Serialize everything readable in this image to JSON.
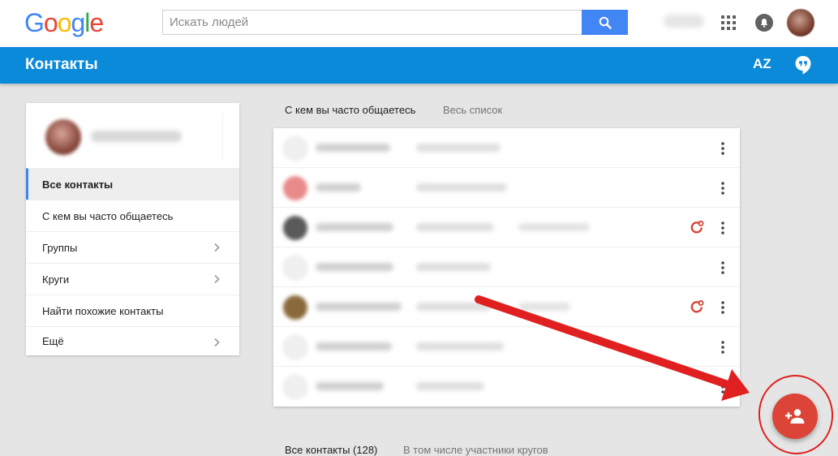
{
  "header": {
    "logo_letters": [
      "G",
      "o",
      "o",
      "g",
      "l",
      "e"
    ],
    "logo_colors": [
      "#4285f4",
      "#ea4335",
      "#fbbc05",
      "#4285f4",
      "#34a853",
      "#ea4335"
    ],
    "search_placeholder": "Искать людей"
  },
  "appbar": {
    "title": "Контакты",
    "sort_label": "AZ"
  },
  "sidebar": {
    "items": [
      {
        "label": "Все контакты",
        "active": true,
        "has_chevron": false
      },
      {
        "label": "С кем вы часто общаетесь",
        "active": false,
        "has_chevron": false
      },
      {
        "label": "Группы",
        "active": false,
        "has_chevron": true
      },
      {
        "label": "Круги",
        "active": false,
        "has_chevron": true
      },
      {
        "label": "Найти похожие контакты",
        "active": false,
        "has_chevron": false
      },
      {
        "label": "Ещё",
        "active": false,
        "has_chevron": true
      }
    ]
  },
  "frequent_section": {
    "title": "С кем вы часто общаетесь",
    "link": "Весь список"
  },
  "contacts": [
    {
      "avatar_icon": "person-placeholder-icon",
      "in_circles": false
    },
    {
      "avatar_icon": "photo-avatar-icon",
      "in_circles": false
    },
    {
      "avatar_icon": "photo-avatar-icon",
      "in_circles": true
    },
    {
      "avatar_icon": "person-placeholder-icon",
      "in_circles": false
    },
    {
      "avatar_icon": "photo-avatar-icon",
      "in_circles": true
    },
    {
      "avatar_icon": "person-placeholder-icon",
      "in_circles": false
    },
    {
      "avatar_icon": "person-placeholder-icon",
      "in_circles": false
    }
  ],
  "all_section": {
    "title": "Все контакты (128)",
    "link": "В том числе участники кругов"
  },
  "colors": {
    "appbar": "#0b8ad9",
    "search_button": "#4285f4",
    "fab": "#db4437",
    "annotation": "#e02020"
  },
  "fab": {
    "icon": "add-person-icon"
  }
}
